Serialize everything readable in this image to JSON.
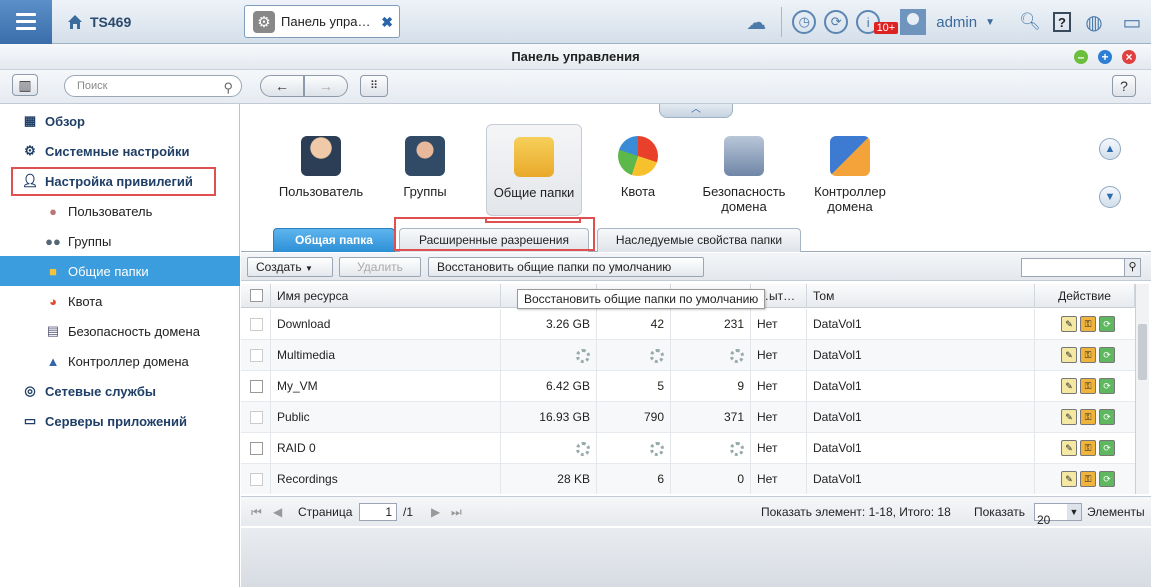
{
  "topbar": {
    "host": "TS469",
    "open_tab": "Панель упра…",
    "notification_badge": "10+",
    "user": "admin"
  },
  "window": {
    "title": "Панель управления"
  },
  "toolbar": {
    "search_placeholder": "Поиск"
  },
  "sidebar": {
    "overview": "Обзор",
    "system": "Системные настройки",
    "privileges": "Настройка привилегий",
    "users": "Пользователь",
    "groups": "Группы",
    "shared": "Общие папки",
    "quota": "Квота",
    "domain_security": "Безопасность домена",
    "domain_controller": "Контроллер домена",
    "network": "Сетевые службы",
    "apps": "Серверы приложений"
  },
  "apps": [
    {
      "label": "Пользователь"
    },
    {
      "label": "Группы"
    },
    {
      "label": "Общие папки"
    },
    {
      "label": "Квота"
    },
    {
      "label": "Безопасность домена"
    },
    {
      "label": "Контроллер домена"
    }
  ],
  "subtabs": {
    "shared_folder": "Общая папка",
    "advanced": "Расширенные разрешения",
    "inherited": "Наследуемые свойства папки"
  },
  "actions": {
    "create": "Создать",
    "delete": "Удалить",
    "restore": "Восстановить общие папки по умолчанию",
    "tooltip": "Восстановить общие папки по умолчанию"
  },
  "grid": {
    "headers": {
      "name": "Имя ресурса",
      "hidden": "…ыт…",
      "volume": "Том",
      "action": "Действие"
    },
    "rows": [
      {
        "name": "Download",
        "size": "3.26 GB",
        "folders": "42",
        "files": "231",
        "hidden": "Нет",
        "volume": "DataVol1"
      },
      {
        "name": "Multimedia",
        "size": "",
        "folders": "",
        "files": "",
        "hidden": "Нет",
        "volume": "DataVol1"
      },
      {
        "name": "My_VM",
        "size": "6.42 GB",
        "folders": "5",
        "files": "9",
        "hidden": "Нет",
        "volume": "DataVol1"
      },
      {
        "name": "Public",
        "size": "16.93 GB",
        "folders": "790",
        "files": "371",
        "hidden": "Нет",
        "volume": "DataVol1"
      },
      {
        "name": "RAID 0",
        "size": "",
        "folders": "",
        "files": "",
        "hidden": "Нет",
        "volume": "DataVol1"
      },
      {
        "name": "Recordings",
        "size": "28 KB",
        "folders": "6",
        "files": "0",
        "hidden": "Нет",
        "volume": "DataVol1"
      }
    ]
  },
  "pager": {
    "page_label": "Страница",
    "page": "1",
    "total": "/1",
    "summary": "Показать элемент: 1-18, Итого: 18",
    "show": "Показать",
    "per_page": "20",
    "items": "Элементы"
  }
}
